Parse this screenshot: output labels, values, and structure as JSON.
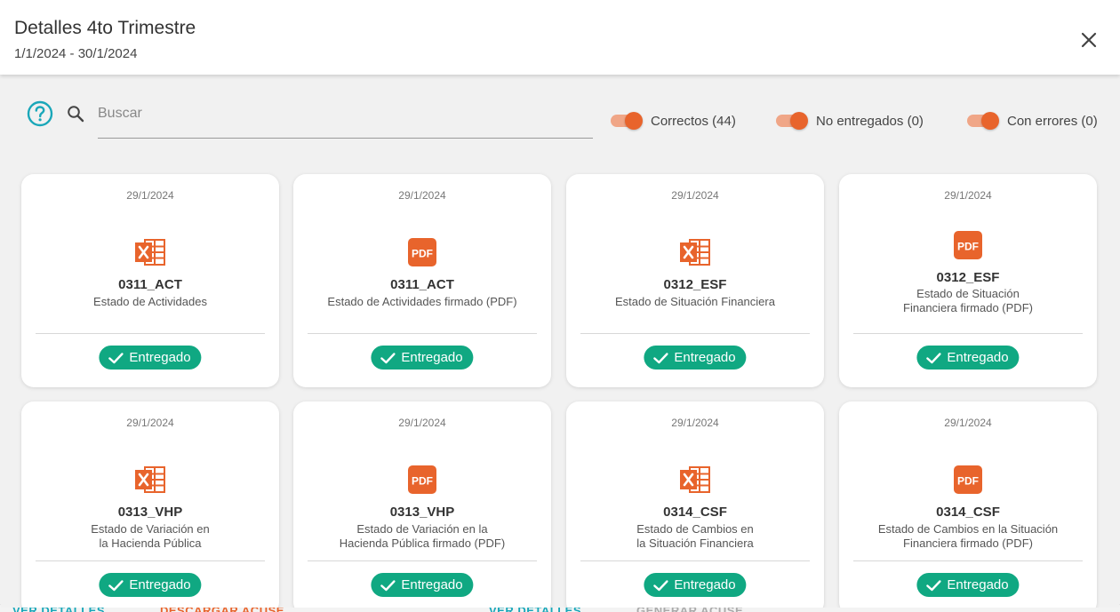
{
  "header": {
    "title": "Detalles 4to Trimestre",
    "subtitle": "1/1/2024 - 30/1/2024"
  },
  "search": {
    "placeholder": "Buscar",
    "value": ""
  },
  "filters": [
    {
      "label": "Correctos (44)",
      "on": true
    },
    {
      "label": "No entregados (0)",
      "on": true
    },
    {
      "label": "Con errores (0)",
      "on": true
    }
  ],
  "cards": [
    {
      "date": "29/1/2024",
      "icon": "excel-icon",
      "code": "0311_ACT",
      "desc": [
        "Estado de Actividades"
      ],
      "status": "Entregado"
    },
    {
      "date": "29/1/2024",
      "icon": "pdf-icon",
      "code": "0311_ACT",
      "desc": [
        "Estado de Actividades firmado (PDF)"
      ],
      "status": "Entregado"
    },
    {
      "date": "29/1/2024",
      "icon": "excel-icon",
      "code": "0312_ESF",
      "desc": [
        "Estado de Situación Financiera"
      ],
      "status": "Entregado"
    },
    {
      "date": "29/1/2024",
      "icon": "pdf-icon",
      "code": "0312_ESF",
      "desc": [
        "Estado de Situación",
        "Financiera firmado (PDF)"
      ],
      "status": "Entregado"
    },
    {
      "date": "29/1/2024",
      "icon": "excel-icon",
      "code": "0313_VHP",
      "desc": [
        "Estado de Variación en",
        "la Hacienda Pública"
      ],
      "status": "Entregado"
    },
    {
      "date": "29/1/2024",
      "icon": "pdf-icon",
      "code": "0313_VHP",
      "desc": [
        "Estado de Variación en la",
        "Hacienda Pública firmado (PDF)"
      ],
      "status": "Entregado"
    },
    {
      "date": "29/1/2024",
      "icon": "excel-icon",
      "code": "0314_CSF",
      "desc": [
        "Estado de Cambios en",
        "la Situación Financiera"
      ],
      "status": "Entregado"
    },
    {
      "date": "29/1/2024",
      "icon": "pdf-icon",
      "code": "0314_CSF",
      "desc": [
        "Estado de Cambios en la Situación",
        "Financiera firmado (PDF)"
      ],
      "status": "Entregado"
    }
  ],
  "background_links": [
    "VER DETALLES",
    "DESCARGAR ACUSE",
    "VER DETALLES",
    "GENERAR ACUSE"
  ],
  "colors": {
    "accent": "#e8642c",
    "success": "#10a882",
    "help": "#1aa7b9"
  }
}
